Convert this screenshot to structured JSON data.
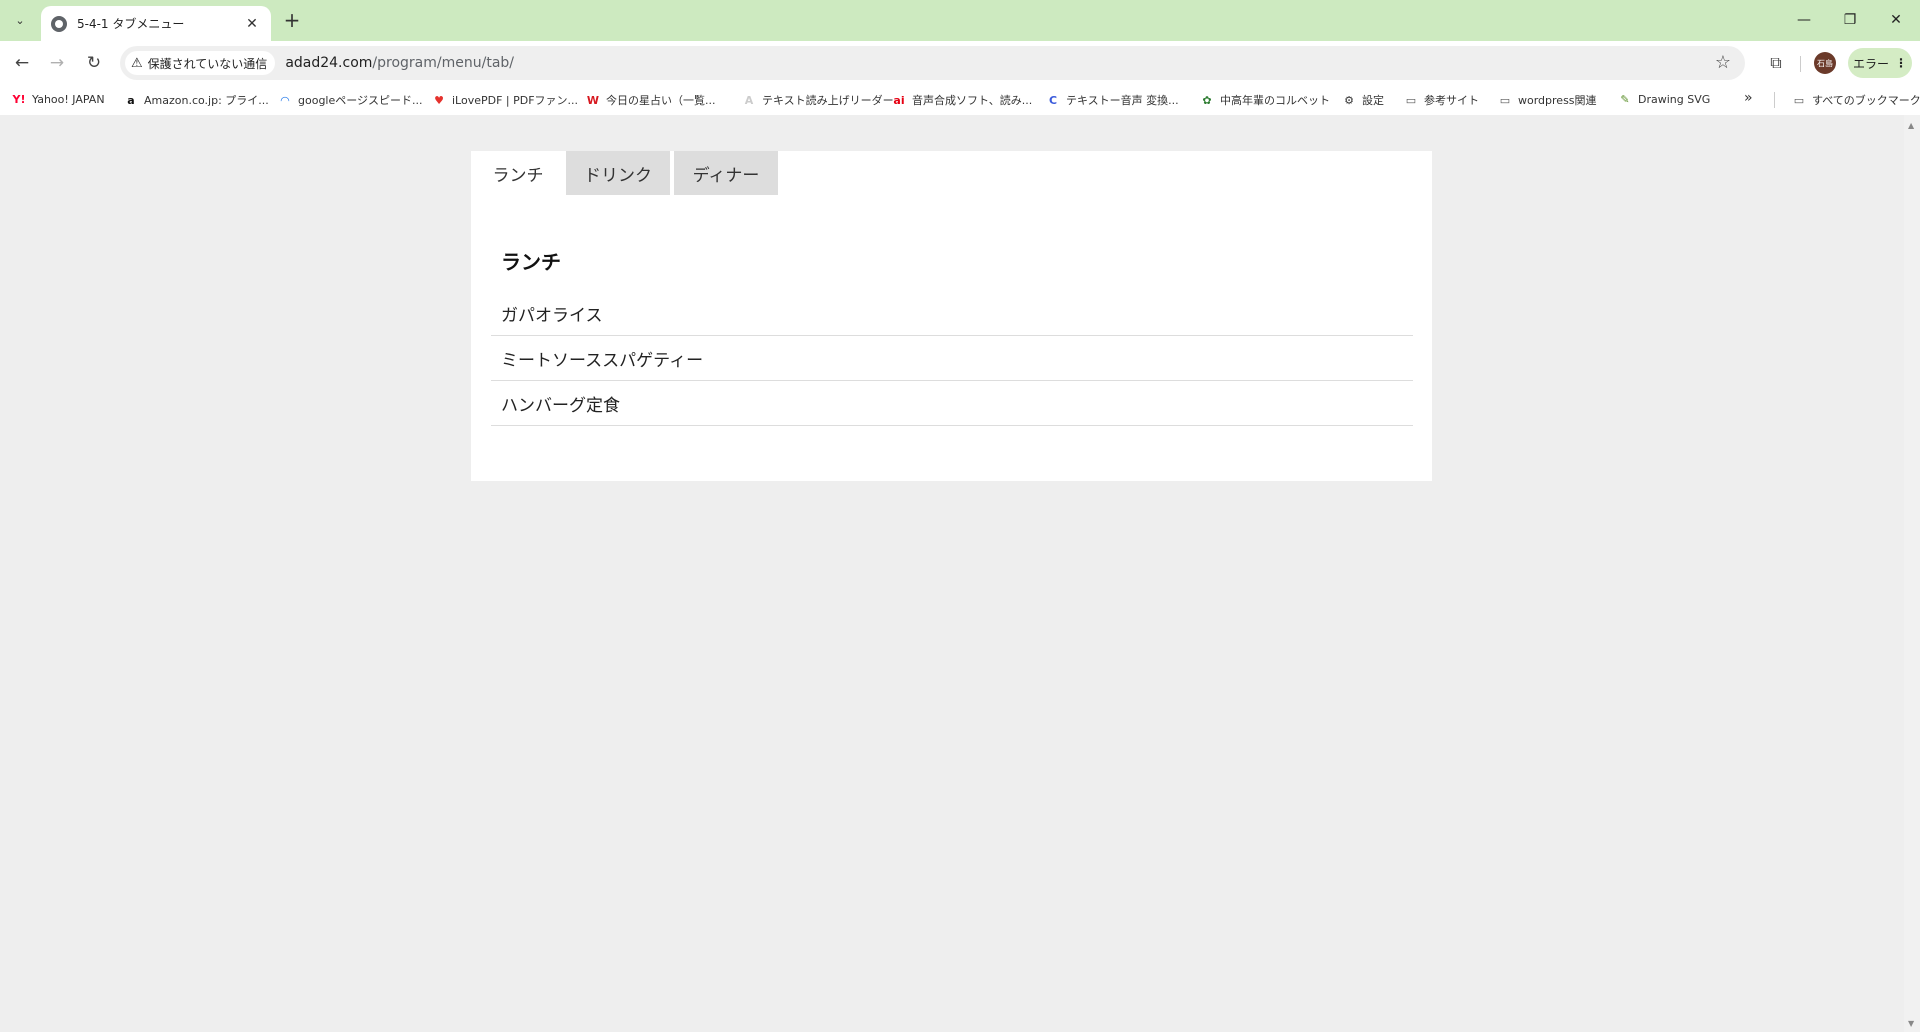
{
  "browser": {
    "tab_title": "5-4-1 タブメニュー",
    "new_tab_symbol": "+",
    "close_symbol": "✕",
    "security_label": "保護されていない通信",
    "url_host": "adad24.com",
    "url_path": "/program/menu/tab/",
    "avatar_text": "石島",
    "error_label": "エラー"
  },
  "bookmarks": [
    {
      "label": "Yahoo! JAPAN",
      "icon": "yahoo-icon",
      "glyph": "Y!",
      "color": "#ff0033"
    },
    {
      "label": "Amazon.co.jp: プライ...",
      "icon": "amazon-icon",
      "glyph": "a",
      "color": "#111111"
    },
    {
      "label": "googleページスピード...",
      "icon": "pagespeed-icon",
      "glyph": "◠",
      "color": "#1a73e8"
    },
    {
      "label": "iLovePDF | PDFファン...",
      "icon": "ilovepdf-icon",
      "glyph": "♥",
      "color": "#e5322d"
    },
    {
      "label": "今日の星占い（一覧...",
      "icon": "horoscope-icon",
      "glyph": "W",
      "color": "#d71920"
    },
    {
      "label": "テキスト読み上げリーダー",
      "icon": "tts-reader-icon",
      "glyph": "A",
      "color": "#cccccc"
    },
    {
      "label": "音声合成ソフト、読み...",
      "icon": "ai-voice-icon",
      "glyph": "ai",
      "color": "#e60012"
    },
    {
      "label": "テキストー音声 変換...",
      "icon": "text-to-speech-icon",
      "glyph": "C",
      "color": "#3b5bdb"
    },
    {
      "label": "中高年輩のコルベット",
      "icon": "frog-icon",
      "glyph": "✿",
      "color": "#2e7d32"
    },
    {
      "label": "設定",
      "icon": "gear-icon",
      "glyph": "⚙",
      "color": "#333333"
    },
    {
      "label": "参考サイト",
      "icon": "folder-icon",
      "glyph": "▭",
      "color": "#555555"
    },
    {
      "label": "wordpress関連",
      "icon": "folder-icon",
      "glyph": "▭",
      "color": "#555555"
    },
    {
      "label": "Drawing SVG",
      "icon": "drawing-svg-icon",
      "glyph": "✎",
      "color": "#5a8f29"
    }
  ],
  "bookmarks_more": "»",
  "all_bookmarks_label": "すべてのブックマーク",
  "menu": {
    "tabs": [
      {
        "label": "ランチ",
        "active": true
      },
      {
        "label": "ドリンク",
        "active": false
      },
      {
        "label": "ディナー",
        "active": false
      }
    ],
    "panel_heading": "ランチ",
    "items": [
      "ガパオライス",
      "ミートソーススパゲティー",
      "ハンバーグ定食"
    ]
  }
}
